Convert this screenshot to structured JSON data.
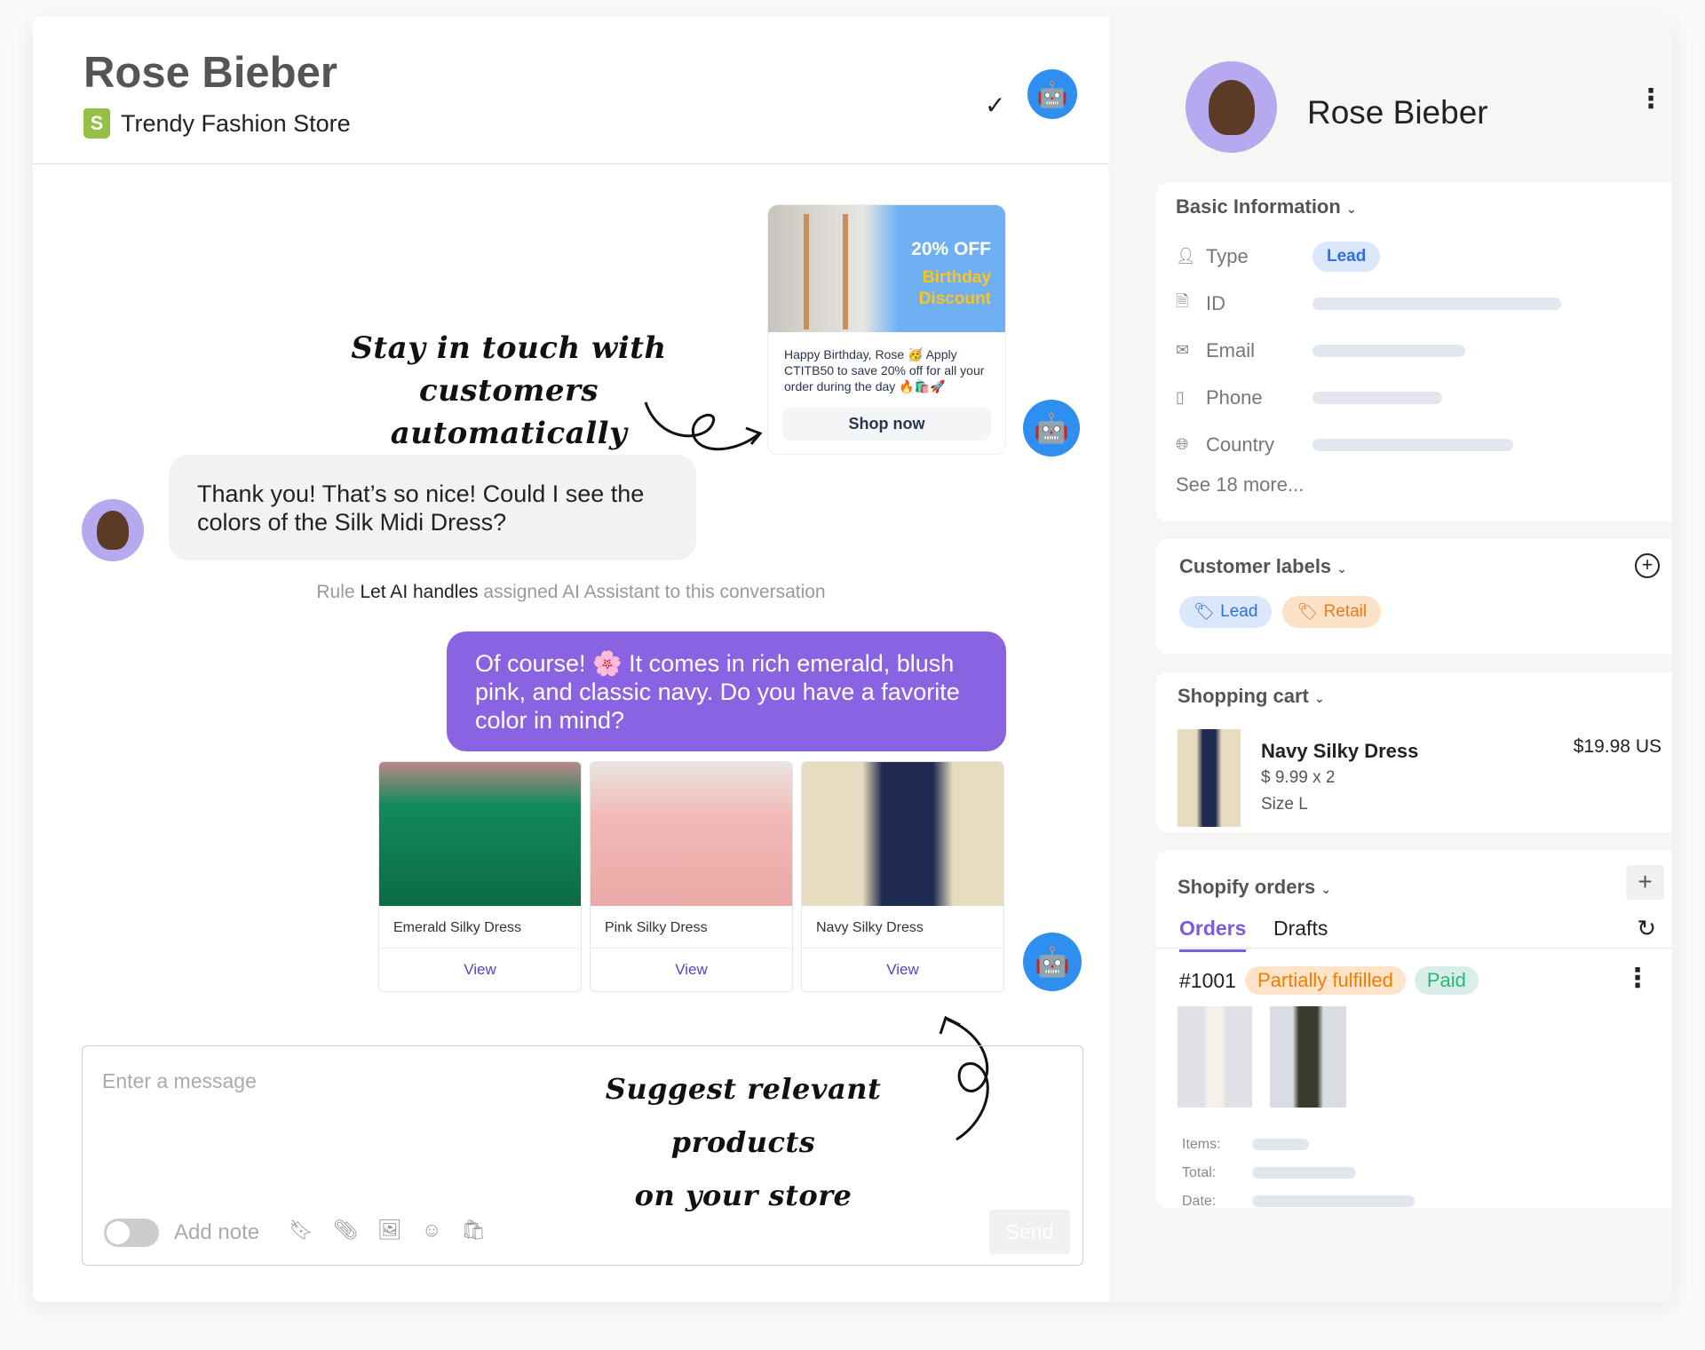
{
  "header": {
    "title": "Rose Bieber",
    "store": "Trendy Fashion Store"
  },
  "promo": {
    "offer": "20% OFF",
    "headline1": "Birthday",
    "headline2": "Discount",
    "message": "Happy Birthday, Rose 🥳 Apply CTITB50 to save 20% off for all your order during the day 🔥🛍️🚀",
    "button": "Shop now"
  },
  "annotations": {
    "top_line1": "Stay in touch with customers",
    "top_line2": "automatically",
    "bottom_line1": "Suggest relevant products",
    "bottom_line2": "on your store"
  },
  "customer_message": "Thank you! That’s so nice! Could I see the colors of the Silk Midi Dress?",
  "rule": {
    "prefix": "Rule",
    "name": "Let AI handles",
    "suffix": "assigned AI Assistant to this conversation"
  },
  "ai_message": "Of course! 🌸 It comes in rich emerald, blush pink, and classic navy. Do you have a favorite color in mind?",
  "products": [
    {
      "name": "Emerald Silky Dress",
      "action": "View",
      "color": "#118a5c"
    },
    {
      "name": "Pink Silky Dress",
      "action": "View",
      "color": "#f2b8b5"
    },
    {
      "name": "Navy Silky Dress",
      "action": "View",
      "color": "#1e2a4f"
    }
  ],
  "composer": {
    "placeholder": "Enter a message",
    "add_note": "Add note",
    "send": "Send"
  },
  "profile": {
    "name": "Rose Bieber"
  },
  "basic_info": {
    "title": "Basic Information",
    "fields": [
      {
        "label": "Type",
        "value": "Lead"
      },
      {
        "label": "ID"
      },
      {
        "label": "Email"
      },
      {
        "label": "Phone"
      },
      {
        "label": "Country"
      }
    ],
    "see_more": "See 18 more..."
  },
  "labels": {
    "title": "Customer labels",
    "items": [
      "Lead",
      "Retail"
    ]
  },
  "cart": {
    "title": "Shopping cart",
    "item": "Navy Silky Dress",
    "price": "$ 9.99 x 2",
    "size": "Size L",
    "total": "$19.98 US"
  },
  "orders": {
    "title": "Shopify orders",
    "tabs": [
      "Orders",
      "Drafts"
    ],
    "order_id": "#1001",
    "fulfillment": "Partially fulfilled",
    "payment": "Paid",
    "items_label": "Items:",
    "total_label": "Total:",
    "date_label": "Date:"
  },
  "colors": {
    "accent": "#7a5ce0",
    "robot": "#2f8ff0",
    "lead": "#2f6fe0",
    "retail": "#f07a1a",
    "paid": "#2bb673"
  }
}
